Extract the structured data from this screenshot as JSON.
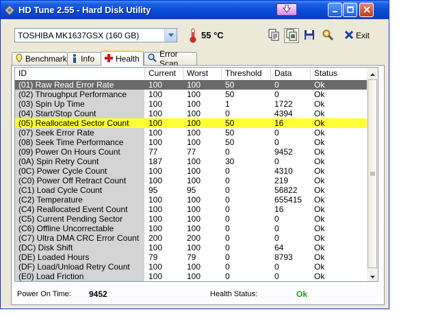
{
  "window": {
    "title": "HD Tune 2.55 - Hard Disk Utility",
    "colors": {
      "titlebar": "#0a4bd6",
      "selected_row": "#6a6a6a",
      "warning_row": "#ffff33",
      "ok_green": "#1a9e1a",
      "tab_highlight": "#ffc83c"
    }
  },
  "toolbar": {
    "drive": "TOSHIBA MK1637GSX (160 GB)",
    "temperature": "55 °C",
    "exit_label": "Exit",
    "icons": [
      "copy-text-icon",
      "copy-screenshot-icon",
      "save-icon",
      "options-icon"
    ]
  },
  "tabs": [
    {
      "label": "Benchmark",
      "icon": "benchmark-icon"
    },
    {
      "label": "Info",
      "icon": "info-icon"
    },
    {
      "label": "Health",
      "icon": "health-cross-icon",
      "active": true
    },
    {
      "label": "Error Scan",
      "icon": "magnifier-icon"
    }
  ],
  "table": {
    "columns": [
      "ID",
      "Current",
      "Worst",
      "Threshold",
      "Data",
      "Status"
    ],
    "rows": [
      [
        "(01) Raw Read Error Rate",
        "100",
        "100",
        "50",
        "0",
        "Ok"
      ],
      [
        "(02) Throughput Performance",
        "100",
        "100",
        "50",
        "0",
        "Ok"
      ],
      [
        "(03) Spin Up Time",
        "100",
        "100",
        "1",
        "1722",
        "Ok"
      ],
      [
        "(04) Start/Stop Count",
        "100",
        "100",
        "0",
        "4394",
        "Ok"
      ],
      [
        "(05) Reallocated Sector Count",
        "100",
        "100",
        "50",
        "16",
        "Ok"
      ],
      [
        "(07) Seek Error Rate",
        "100",
        "100",
        "50",
        "0",
        "Ok"
      ],
      [
        "(08) Seek Time Performance",
        "100",
        "100",
        "50",
        "0",
        "Ok"
      ],
      [
        "(09) Power On Hours Count",
        "77",
        "77",
        "0",
        "9452",
        "Ok"
      ],
      [
        "(0A) Spin Retry Count",
        "187",
        "100",
        "30",
        "0",
        "Ok"
      ],
      [
        "(0C) Power Cycle Count",
        "100",
        "100",
        "0",
        "4310",
        "Ok"
      ],
      [
        "(C0) Power Off Retract Count",
        "100",
        "100",
        "0",
        "219",
        "Ok"
      ],
      [
        "(C1) Load Cycle Count",
        "95",
        "95",
        "0",
        "56822",
        "Ok"
      ],
      [
        "(C2) Temperature",
        "100",
        "100",
        "0",
        "655415",
        "Ok"
      ],
      [
        "(C4) Reallocated Event Count",
        "100",
        "100",
        "0",
        "16",
        "Ok"
      ],
      [
        "(C5) Current Pending Sector",
        "100",
        "100",
        "0",
        "0",
        "Ok"
      ],
      [
        "(C6) Offline Uncorrectable",
        "100",
        "100",
        "0",
        "0",
        "Ok"
      ],
      [
        "(C7) Ultra DMA CRC Error Count",
        "200",
        "200",
        "0",
        "0",
        "Ok"
      ],
      [
        "(DC) Disk Shift",
        "100",
        "100",
        "0",
        "64",
        "Ok"
      ],
      [
        "(DE) Loaded Hours",
        "79",
        "79",
        "0",
        "8793",
        "Ok"
      ],
      [
        "(DF) Load/Unload Retry Count",
        "100",
        "100",
        "0",
        "0",
        "Ok"
      ],
      [
        "(E0) Load Friction",
        "100",
        "100",
        "0",
        "0",
        "Ok"
      ]
    ],
    "selected_row": 0,
    "highlighted_row": 4
  },
  "footer": {
    "power_on_label": "Power On Time:",
    "power_on_value": "9452",
    "health_label": "Health Status:",
    "health_value": "Ok"
  }
}
